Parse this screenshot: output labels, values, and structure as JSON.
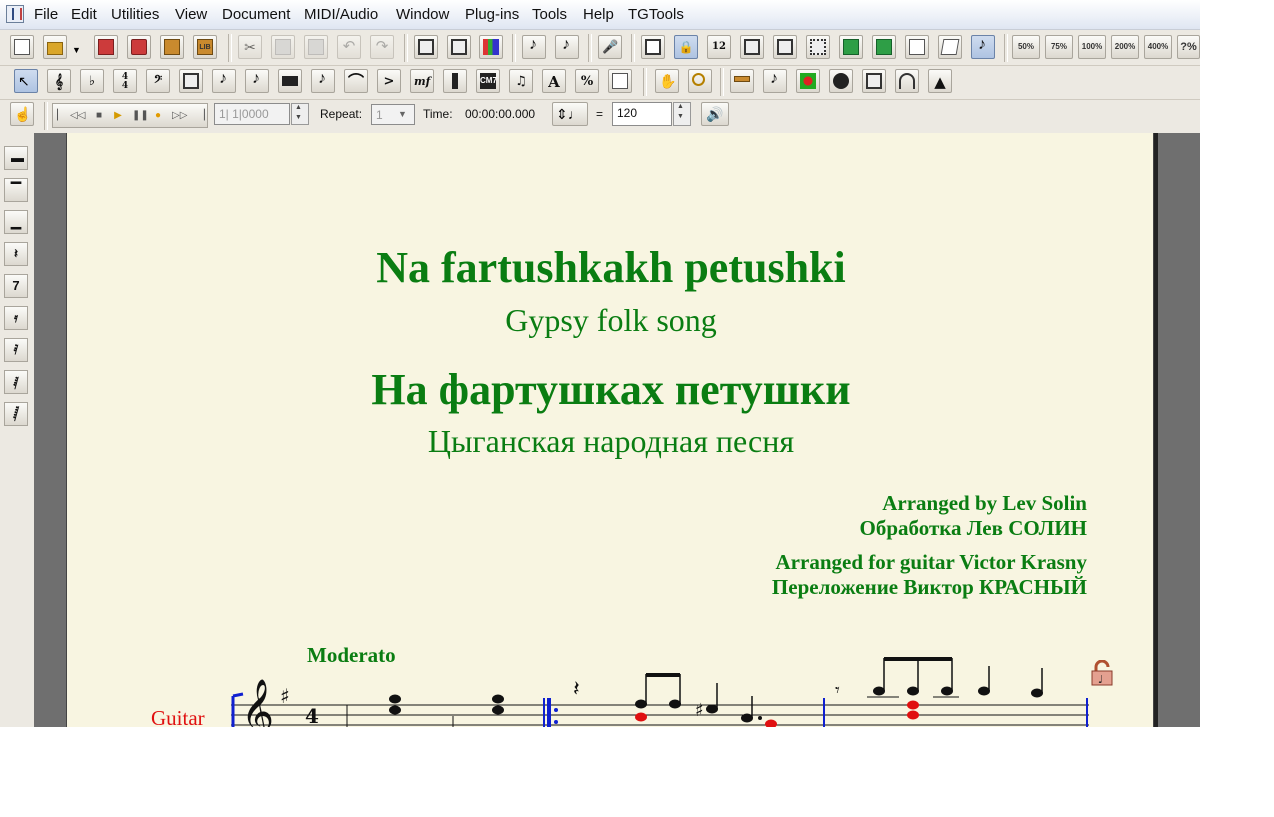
{
  "menu": [
    "File",
    "Edit",
    "Utilities",
    "View",
    "Document",
    "MIDI/Audio",
    "Window",
    "Plug-ins",
    "Tools",
    "Help",
    "TGTools"
  ],
  "zoom_buttons": [
    "50%",
    "75%",
    "100%",
    "200%",
    "400%",
    "?%"
  ],
  "toolbar_labels": {
    "lib": "LIB",
    "cm7": "CM7",
    "mf": "mf",
    "letter_a": "A",
    "percent": "%"
  },
  "transport": {
    "position": "1| 1|0000",
    "repeat_label": "Repeat:",
    "repeat_value": "1",
    "time_label": "Time:",
    "time_value": "00:00:00.000",
    "equals": "=",
    "tempo": "120"
  },
  "score": {
    "title": "Na fartushkakh petushki",
    "subtitle": "Gypsy folk song",
    "title_ru": "На фартушках петушки",
    "subtitle_ru": "Цыганская народная песня",
    "credits": [
      "Arranged by Lev Solin",
      "Обработка Лев СОЛИН",
      "Arranged for guitar Victor Krasny",
      "Переложение Виктор КРАСНЫЙ"
    ],
    "tempo_marking": "Moderato",
    "instrument": "Guitar",
    "key_signature": "sharp",
    "colors": {
      "text": "#0a7d12",
      "instrument": "#e01010",
      "barline": "#0000cc",
      "highlight_note": "#e01010"
    }
  }
}
